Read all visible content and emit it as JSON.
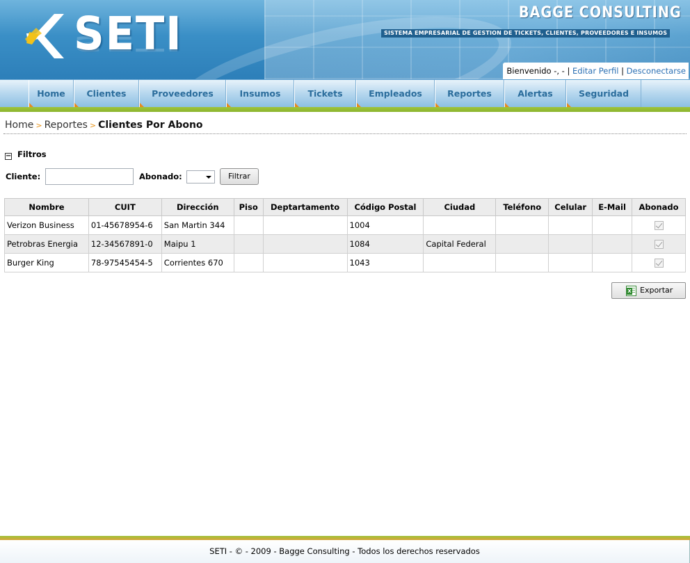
{
  "header": {
    "logo_text": "SETI",
    "company_name": "BAGGE CONSULTING",
    "tagline": "SISTEMA EMPRESARIAL DE GESTION DE TICKETS, CLIENTES, PROVEEDORES E INSUMOS",
    "welcome": "Bienvenido -, -",
    "separator": "|",
    "edit_profile": "Editar Perfil",
    "logout": "Desconectarse"
  },
  "nav": {
    "items": [
      {
        "label": "Home"
      },
      {
        "label": "Clientes"
      },
      {
        "label": "Proveedores"
      },
      {
        "label": "Insumos"
      },
      {
        "label": "Tickets"
      },
      {
        "label": "Empleados"
      },
      {
        "label": "Reportes"
      },
      {
        "label": "Alertas"
      },
      {
        "label": "Seguridad"
      }
    ]
  },
  "breadcrumb": {
    "home": "Home",
    "sep": ">",
    "reportes": "Reportes",
    "current": "Clientes Por Abono"
  },
  "filters": {
    "toggle": "−",
    "title": "Filtros",
    "cliente_label": "Cliente:",
    "cliente_value": "",
    "abonado_label": "Abonado:",
    "abonado_value": "",
    "filter_button": "Filtrar"
  },
  "table": {
    "columns": [
      "Nombre",
      "CUIT",
      "Dirección",
      "Piso",
      "Deptartamento",
      "Código Postal",
      "Ciudad",
      "Teléfono",
      "Celular",
      "E-Mail",
      "Abonado"
    ],
    "rows": [
      {
        "nombre": "Verizon Business",
        "cuit": "01-45678954-6",
        "direccion": "San Martin 344",
        "piso": "",
        "departamento": "",
        "codigo_postal": "1004",
        "ciudad": "",
        "telefono": "",
        "celular": "",
        "email": "",
        "abonado": true
      },
      {
        "nombre": "Petrobras Energia",
        "cuit": "12-34567891-0",
        "direccion": "Maipu 1",
        "piso": "",
        "departamento": "",
        "codigo_postal": "1084",
        "ciudad": "Capital Federal",
        "telefono": "",
        "celular": "",
        "email": "",
        "abonado": true
      },
      {
        "nombre": "Burger King",
        "cuit": "78-97545454-5",
        "direccion": "Corrientes 670",
        "piso": "",
        "departamento": "",
        "codigo_postal": "1043",
        "ciudad": "",
        "telefono": "",
        "celular": "",
        "email": "",
        "abonado": true
      }
    ]
  },
  "export": {
    "label": "Exportar",
    "icon": "excel-icon"
  },
  "footer": {
    "text": "SETI - © - 2009 - Bagge Consulting - Todos los derechos reservados"
  },
  "colors": {
    "nav_text": "#2b6d9c",
    "link": "#2a6fb3",
    "accent_green": "#9fc33a",
    "accent_orange": "#e88a1e"
  }
}
